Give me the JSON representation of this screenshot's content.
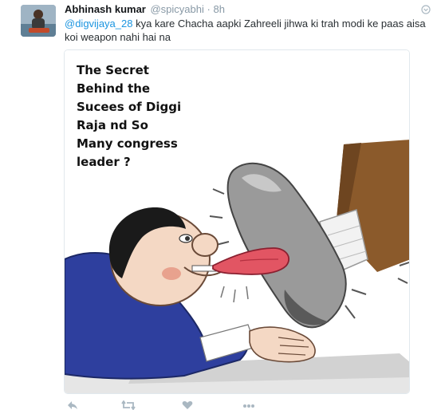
{
  "tweet": {
    "author_name": "Abhinash kumar",
    "author_handle": "@spicyabhi",
    "separator": "·",
    "time": "8h",
    "mention": "@digvijaya_28",
    "text": " kya kare Chacha aapki  Zahreeli jihwa ki trah modi ke paas aisa koi weapon nahi hai na"
  },
  "media": {
    "caption": "The Secret\nBehind the\nSucees of Diggi\nRaja nd So\nMany congress\nleader ?"
  },
  "icons": {
    "menu": "chevron-down-icon",
    "reply": "reply-icon",
    "retweet": "retweet-icon",
    "like": "heart-icon",
    "more": "more-icon"
  }
}
